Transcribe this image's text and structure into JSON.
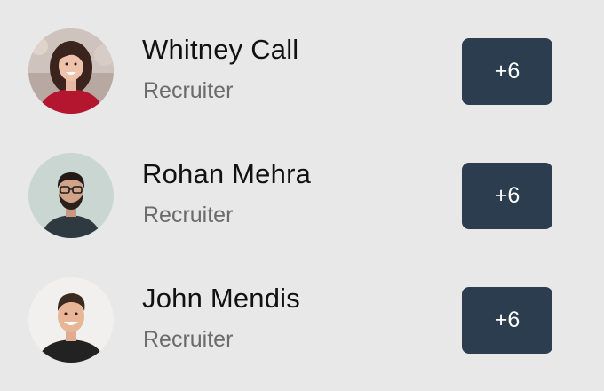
{
  "people": [
    {
      "name": "Whitney Call",
      "role": "Recruiter",
      "count": "+6"
    },
    {
      "name": "Rohan Mehra",
      "role": "Recruiter",
      "count": "+6"
    },
    {
      "name": "John Mendis",
      "role": "Recruiter",
      "count": "+6"
    }
  ]
}
